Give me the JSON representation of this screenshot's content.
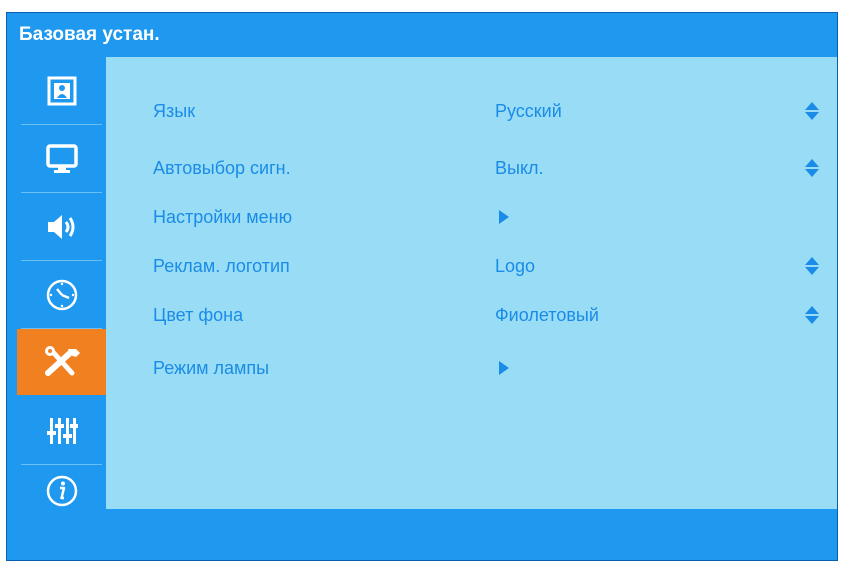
{
  "window": {
    "title": "Базовая устан."
  },
  "sidebar": {
    "items": [
      {
        "icon": "picture-icon",
        "active": false
      },
      {
        "icon": "monitor-icon",
        "active": false
      },
      {
        "icon": "speaker-icon",
        "active": false
      },
      {
        "icon": "clock-icon",
        "active": false
      },
      {
        "icon": "tools-icon",
        "active": true
      },
      {
        "icon": "equalizer-icon",
        "active": false
      },
      {
        "icon": "info-icon",
        "active": false
      }
    ]
  },
  "menu": {
    "rows": [
      {
        "label": "Язык",
        "value": "Русский",
        "control": "updown"
      },
      {
        "label": "Автовыбор сигн.",
        "value": "Выкл.",
        "control": "updown"
      },
      {
        "label": "Настройки меню",
        "value": "",
        "control": "submenu"
      },
      {
        "label": "Реклам. логотип",
        "value": "Logo",
        "control": "updown"
      },
      {
        "label": "Цвет фона",
        "value": "Фиолетовый",
        "control": "updown"
      },
      {
        "label": "Режим лампы",
        "value": "",
        "control": "submenu"
      }
    ]
  },
  "colors": {
    "frame": "#1f98f0",
    "content": "#99dcf5",
    "text": "#1a8ce8",
    "active": "#f08020"
  }
}
